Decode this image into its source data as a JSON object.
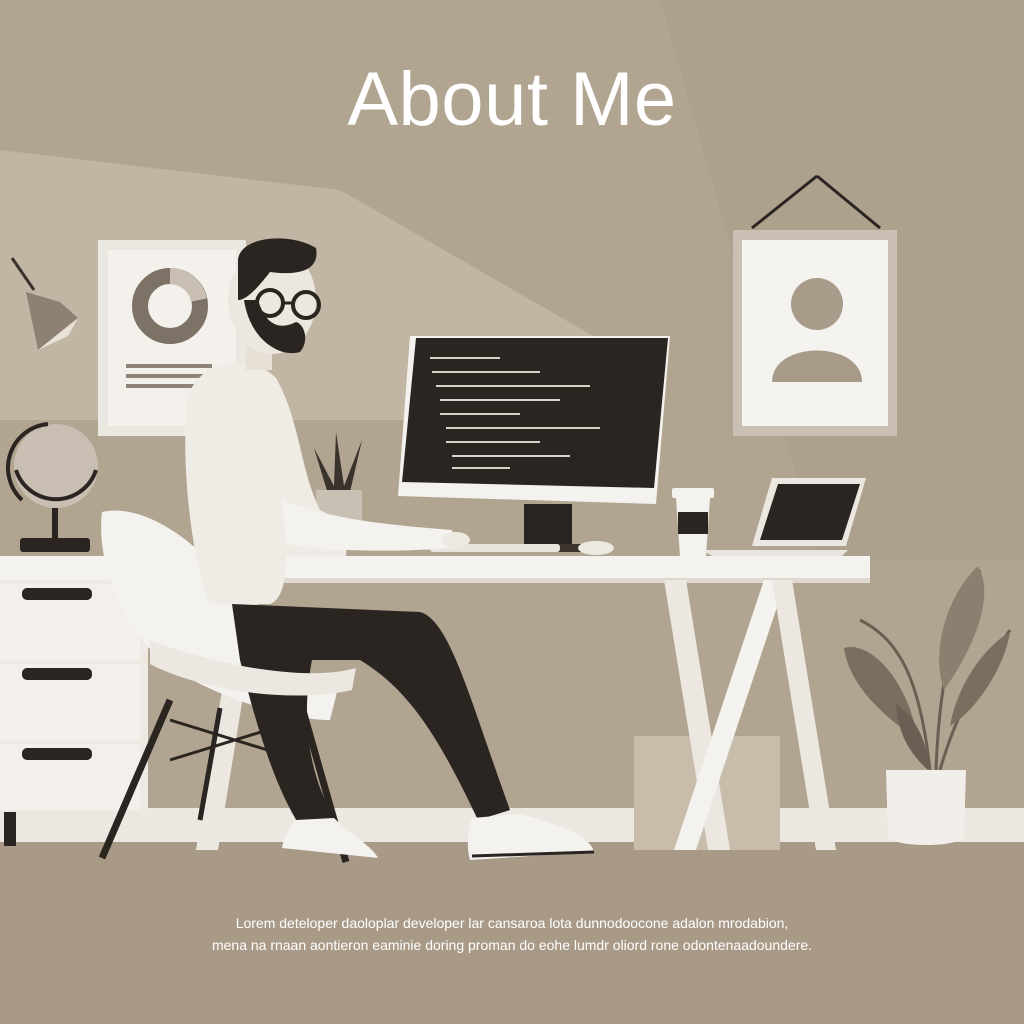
{
  "title": "About Me",
  "bio": {
    "line1": "Lorem deteloper daoloplar developer lar cansaroa lota dunnodoocone adalon mrodabion,",
    "line2": "mena na rnaan aontieron eaminie doring proman do eohe lumdr oliord rone odontenaadoundere."
  },
  "colors": {
    "background": "#b1a491",
    "text": "#ffffff",
    "dark": "#2b2522",
    "light": "#f2efea"
  }
}
